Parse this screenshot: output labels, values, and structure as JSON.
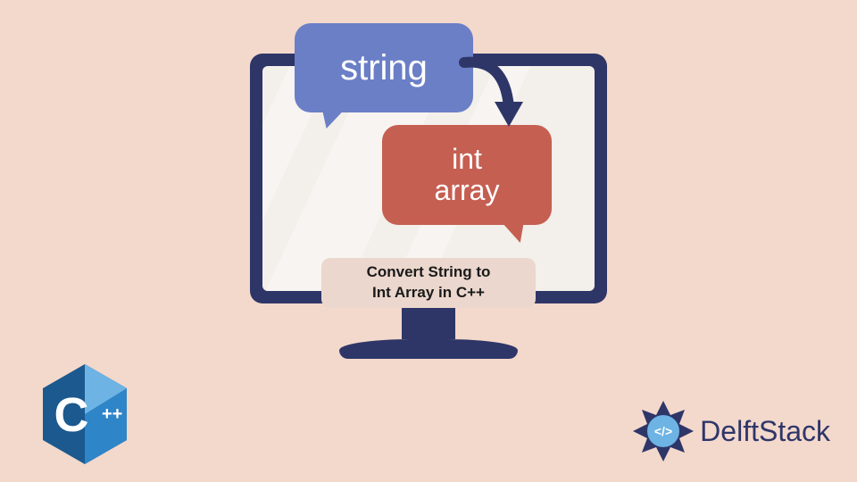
{
  "bubble1_text": "string",
  "bubble2_text": "int\narray",
  "caption": "Convert String to\nInt Array in C++",
  "brand_name": "DelftStack",
  "cpp_label": "C",
  "cpp_plus": "++",
  "colors": {
    "background": "#f3d8cc",
    "monitor": "#2e3668",
    "bubble_string": "#6b7fc7",
    "bubble_int": "#c55f52"
  }
}
